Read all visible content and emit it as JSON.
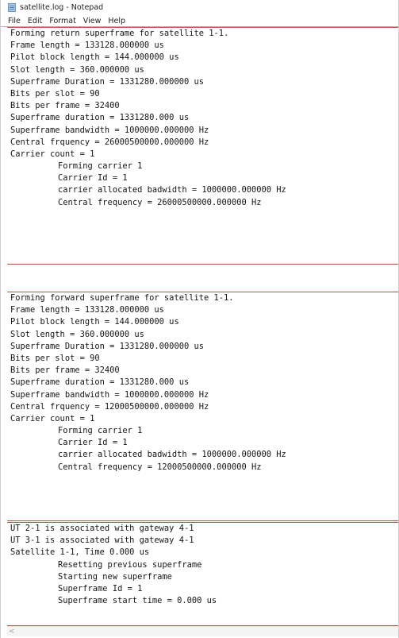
{
  "window": {
    "title": "satellite.log - Notepad"
  },
  "menu": [
    "File",
    "Edit",
    "Format",
    "View",
    "Help"
  ],
  "blocks": [
    {
      "lines": [
        {
          "text": "Forming return superframe for satellite 1-1.",
          "indent": false
        },
        {
          "text": "Frame length = 133128.000000 us",
          "indent": false
        },
        {
          "text": "Pilot block length = 144.000000 us",
          "indent": false
        },
        {
          "text": "Slot length = 360.000000 us",
          "indent": false
        },
        {
          "text": "Superframe Duration = 1331280.000000 us",
          "indent": false
        },
        {
          "text": "Bits per slot = 90",
          "indent": false
        },
        {
          "text": "Bits per frame = 32400",
          "indent": false
        },
        {
          "text": "Superframe duration = 1331280.000 us",
          "indent": false
        },
        {
          "text": "Superframe bandwidth = 1000000.000000 Hz",
          "indent": false
        },
        {
          "text": "Central frquency = 26000500000.000000 Hz",
          "indent": false
        },
        {
          "text": "Carrier count = 1",
          "indent": false
        },
        {
          "text": "Forming carrier 1",
          "indent": true
        },
        {
          "text": "Carrier Id = 1",
          "indent": true
        },
        {
          "text": "carrier allocated badwidth = 1000000.000000 Hz",
          "indent": true
        },
        {
          "text": "Central frequency = 26000500000.000000 Hz",
          "indent": true
        }
      ]
    },
    {
      "lines": [
        {
          "text": "Forming forward superframe for satellite 1-1.",
          "indent": false
        },
        {
          "text": "Frame length = 133128.000000 us",
          "indent": false
        },
        {
          "text": "Pilot block length = 144.000000 us",
          "indent": false
        },
        {
          "text": "Slot length = 360.000000 us",
          "indent": false
        },
        {
          "text": "Superframe Duration = 1331280.000000 us",
          "indent": false
        },
        {
          "text": "Bits per slot = 90",
          "indent": false
        },
        {
          "text": "Bits per frame = 32400",
          "indent": false
        },
        {
          "text": "Superframe duration = 1331280.000 us",
          "indent": false
        },
        {
          "text": "Superframe bandwidth = 1000000.000000 Hz",
          "indent": false
        },
        {
          "text": "Central frquency = 12000500000.000000 Hz",
          "indent": false
        },
        {
          "text": "Carrier count = 1",
          "indent": false
        },
        {
          "text": "Forming carrier 1",
          "indent": true
        },
        {
          "text": "Carrier Id = 1",
          "indent": true
        },
        {
          "text": "carrier allocated badwidth = 1000000.000000 Hz",
          "indent": true
        },
        {
          "text": "Central frequency = 12000500000.000000 Hz",
          "indent": true
        }
      ]
    },
    {
      "lines": [
        {
          "text": "UT 2-1 is associated with gateway 4-1",
          "indent": false
        },
        {
          "text": "UT 3-1 is associated with gateway 4-1",
          "indent": false
        },
        {
          "text": "Satellite 1-1, Time 0.000 us",
          "indent": false
        },
        {
          "text": "Resetting previous superframe",
          "indent": true
        },
        {
          "text": "Starting new superframe",
          "indent": true
        },
        {
          "text": "Superframe Id = 1",
          "indent": true
        },
        {
          "text": "Superframe start time = 0.000 us",
          "indent": true
        }
      ]
    }
  ],
  "scrollbar": {
    "left_arrow": "<"
  },
  "icons": {
    "app": "notepad-icon"
  }
}
